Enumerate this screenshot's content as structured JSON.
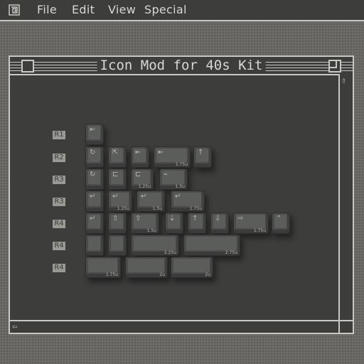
{
  "menubar": {
    "apple_icon": "apple-menu-icon",
    "items": [
      {
        "label": "File"
      },
      {
        "label": "Edit"
      },
      {
        "label": "View"
      },
      {
        "label": "Special"
      }
    ]
  },
  "window": {
    "title": "Icon Mod for 40s Kit"
  },
  "row_labels": [
    "R1",
    "R2",
    "R3",
    "R3",
    "R4",
    "R4",
    "R4"
  ],
  "keys": [
    {
      "glyph": "⇤",
      "size": ""
    },
    {
      "glyph": "↻",
      "size": ""
    },
    {
      "glyph": "⇱",
      "size": ""
    },
    {
      "glyph": "⇤",
      "size": ""
    },
    {
      "glyph": "⇤",
      "size": "1.75u"
    },
    {
      "glyph": "↑",
      "size": ""
    },
    {
      "glyph": "↻",
      "size": ""
    },
    {
      "glyph": "⊏",
      "size": ""
    },
    {
      "glyph": "⊏",
      "size": "1.25u"
    },
    {
      "glyph": "⌁",
      "size": "1.5u"
    },
    {
      "glyph": "↵",
      "size": ""
    },
    {
      "glyph": "↵",
      "size": "1.25u"
    },
    {
      "glyph": "↵",
      "size": "1.5u"
    },
    {
      "glyph": "↵",
      "size": "1.75u"
    },
    {
      "glyph": "↵",
      "size": ""
    },
    {
      "glyph": "⇧",
      "size": ""
    },
    {
      "glyph": "⇧",
      "size": "1.5u"
    },
    {
      "glyph": "⇣",
      "size": ""
    },
    {
      "glyph": "↑",
      "size": ""
    },
    {
      "glyph": "⇩",
      "size": ""
    },
    {
      "glyph": "⇨",
      "size": "1.75u"
    },
    {
      "glyph": "⌃",
      "size": ""
    },
    {
      "glyph": "",
      "size": ""
    },
    {
      "glyph": "",
      "size": ""
    },
    {
      "glyph": "",
      "size": "2.25u"
    },
    {
      "glyph": "",
      "size": "2.75u"
    },
    {
      "glyph": "",
      "size": "1.75u"
    },
    {
      "glyph": "",
      "size": "2u"
    },
    {
      "glyph": "",
      "size": "2u"
    }
  ],
  "colors": {
    "desktop": "#6c6b67",
    "window_bg": "#3d3d3b",
    "chrome_line": "#c9c8c2",
    "keycap": "#4b4d4b"
  }
}
